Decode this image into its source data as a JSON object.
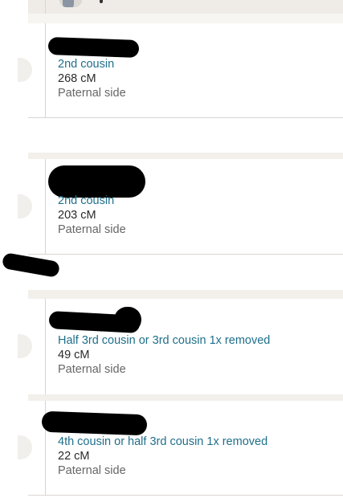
{
  "matches": [
    {
      "relationship": "2nd cousin",
      "shared_dna": "268 cM",
      "side": "Paternal side"
    },
    {
      "relationship": "2nd cousin",
      "shared_dna": "203 cM",
      "side": "Paternal side"
    },
    {
      "relationship": "Half 3rd cousin or 3rd cousin 1x removed",
      "shared_dna": "49 cM",
      "side": "Paternal side"
    },
    {
      "relationship": "4th cousin or half 3rd cousin 1x removed",
      "shared_dna": "22 cM",
      "side": "Paternal side"
    }
  ]
}
